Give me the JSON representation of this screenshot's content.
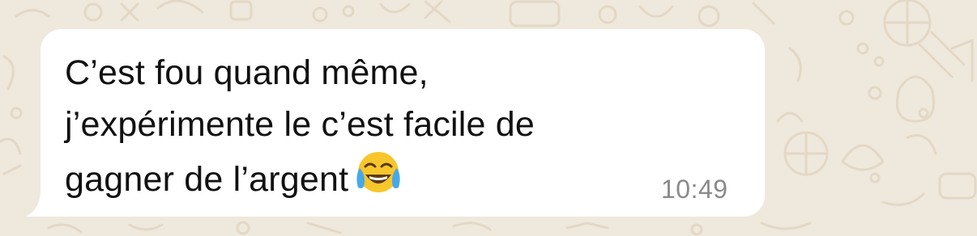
{
  "message": {
    "lines": [
      "C’est fou quand même,",
      "j’expérimente le c’est facile de",
      "gagner de l’argent"
    ],
    "emoji": "face-with-tears-of-joy",
    "time": "10:49"
  },
  "colors": {
    "background": "#efe8dc",
    "bubble": "#ffffff",
    "text": "#111111",
    "timestamp": "#8a8a8a"
  }
}
